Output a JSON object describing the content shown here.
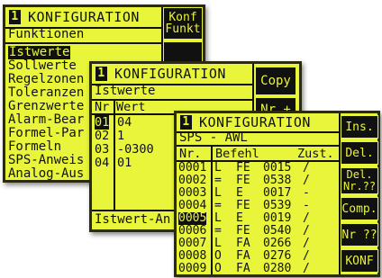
{
  "panel1": {
    "title_num": "1",
    "title": "KONFIGURATION",
    "subtitle": "Funktionen",
    "side_buttons": [
      "Konf",
      "Funkt"
    ],
    "items": [
      "Istwerte",
      "Sollwerte",
      "Regelzonen",
      "Toleranzen",
      "Grenzwerte",
      "Alarm-Bear",
      "Formel-Par",
      "Formeln",
      "SPS-Anweis",
      "Analog-Aus"
    ]
  },
  "panel2": {
    "title_num": "1",
    "title": "KONFIGURATION",
    "subtitle": "Istwerte",
    "col_nr": "Nr",
    "col_wert": "Wert",
    "rows": [
      {
        "nr": "01",
        "wert": "04"
      },
      {
        "nr": "02",
        "wert": "1"
      },
      {
        "nr": "03",
        "wert": "-0300"
      },
      {
        "nr": "04",
        "wert": "01"
      }
    ],
    "footer": "Istwert-An",
    "side_buttons": [
      "Copy",
      "Nr +"
    ]
  },
  "panel3": {
    "title_num": "1",
    "title": "KONFIGURATION",
    "subtitle": "SPS - AWL",
    "col_nr": "Nr.",
    "col_befehl": "Befehl",
    "col_zust": "Zust.",
    "rows": [
      {
        "nr": "0001",
        "op": "L",
        "arg": "FE",
        "val": "0015",
        "z": "/"
      },
      {
        "nr": "0002",
        "op": "=",
        "arg": "FE",
        "val": "0538",
        "z": "/"
      },
      {
        "nr": "0003",
        "op": "L",
        "arg": "E",
        "val": "0017",
        "z": "-"
      },
      {
        "nr": "0004",
        "op": "=",
        "arg": "FE",
        "val": "0539",
        "z": "-"
      },
      {
        "nr": "0005",
        "op": "L",
        "arg": "E",
        "val": "0019",
        "z": "/"
      },
      {
        "nr": "0006",
        "op": "=",
        "arg": "FE",
        "val": "0540",
        "z": "/"
      },
      {
        "nr": "0007",
        "op": "L",
        "arg": "FA",
        "val": "0266",
        "z": "/"
      },
      {
        "nr": "0008",
        "op": "O",
        "arg": "FA",
        "val": "0276",
        "z": "/"
      },
      {
        "nr": "0009",
        "op": "O",
        "arg": "FA",
        "val": "0280",
        "z": "/"
      }
    ],
    "side_buttons": [
      "Ins.",
      "Del.",
      "Del.\nNr.??",
      "Comp.",
      "Nr ??",
      "KONF"
    ]
  },
  "colors": {
    "lcd": "#e8f53a",
    "ink": "#111111"
  }
}
